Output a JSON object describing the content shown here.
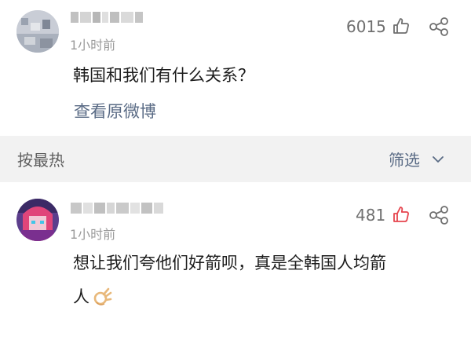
{
  "comments": [
    {
      "time": "1小时前",
      "likes": "6015",
      "text": "韩国和我们有什么关系？",
      "link": "查看原微博",
      "liked": false
    },
    {
      "time": "1小时前",
      "likes": "481",
      "text_line1": "想让我们夸他们好箭呗，真是全韩国人均箭",
      "text_line2": "人",
      "liked": true
    }
  ],
  "sort": {
    "label": "按最热",
    "filter_label": "筛选"
  },
  "colors": {
    "liked": "#e6454f",
    "link": "#5a6b85",
    "muted": "#9a9a9a"
  },
  "icons": [
    "thumb-up-icon",
    "share-icon",
    "chevron-down-icon",
    "ok-hand-emoji"
  ]
}
